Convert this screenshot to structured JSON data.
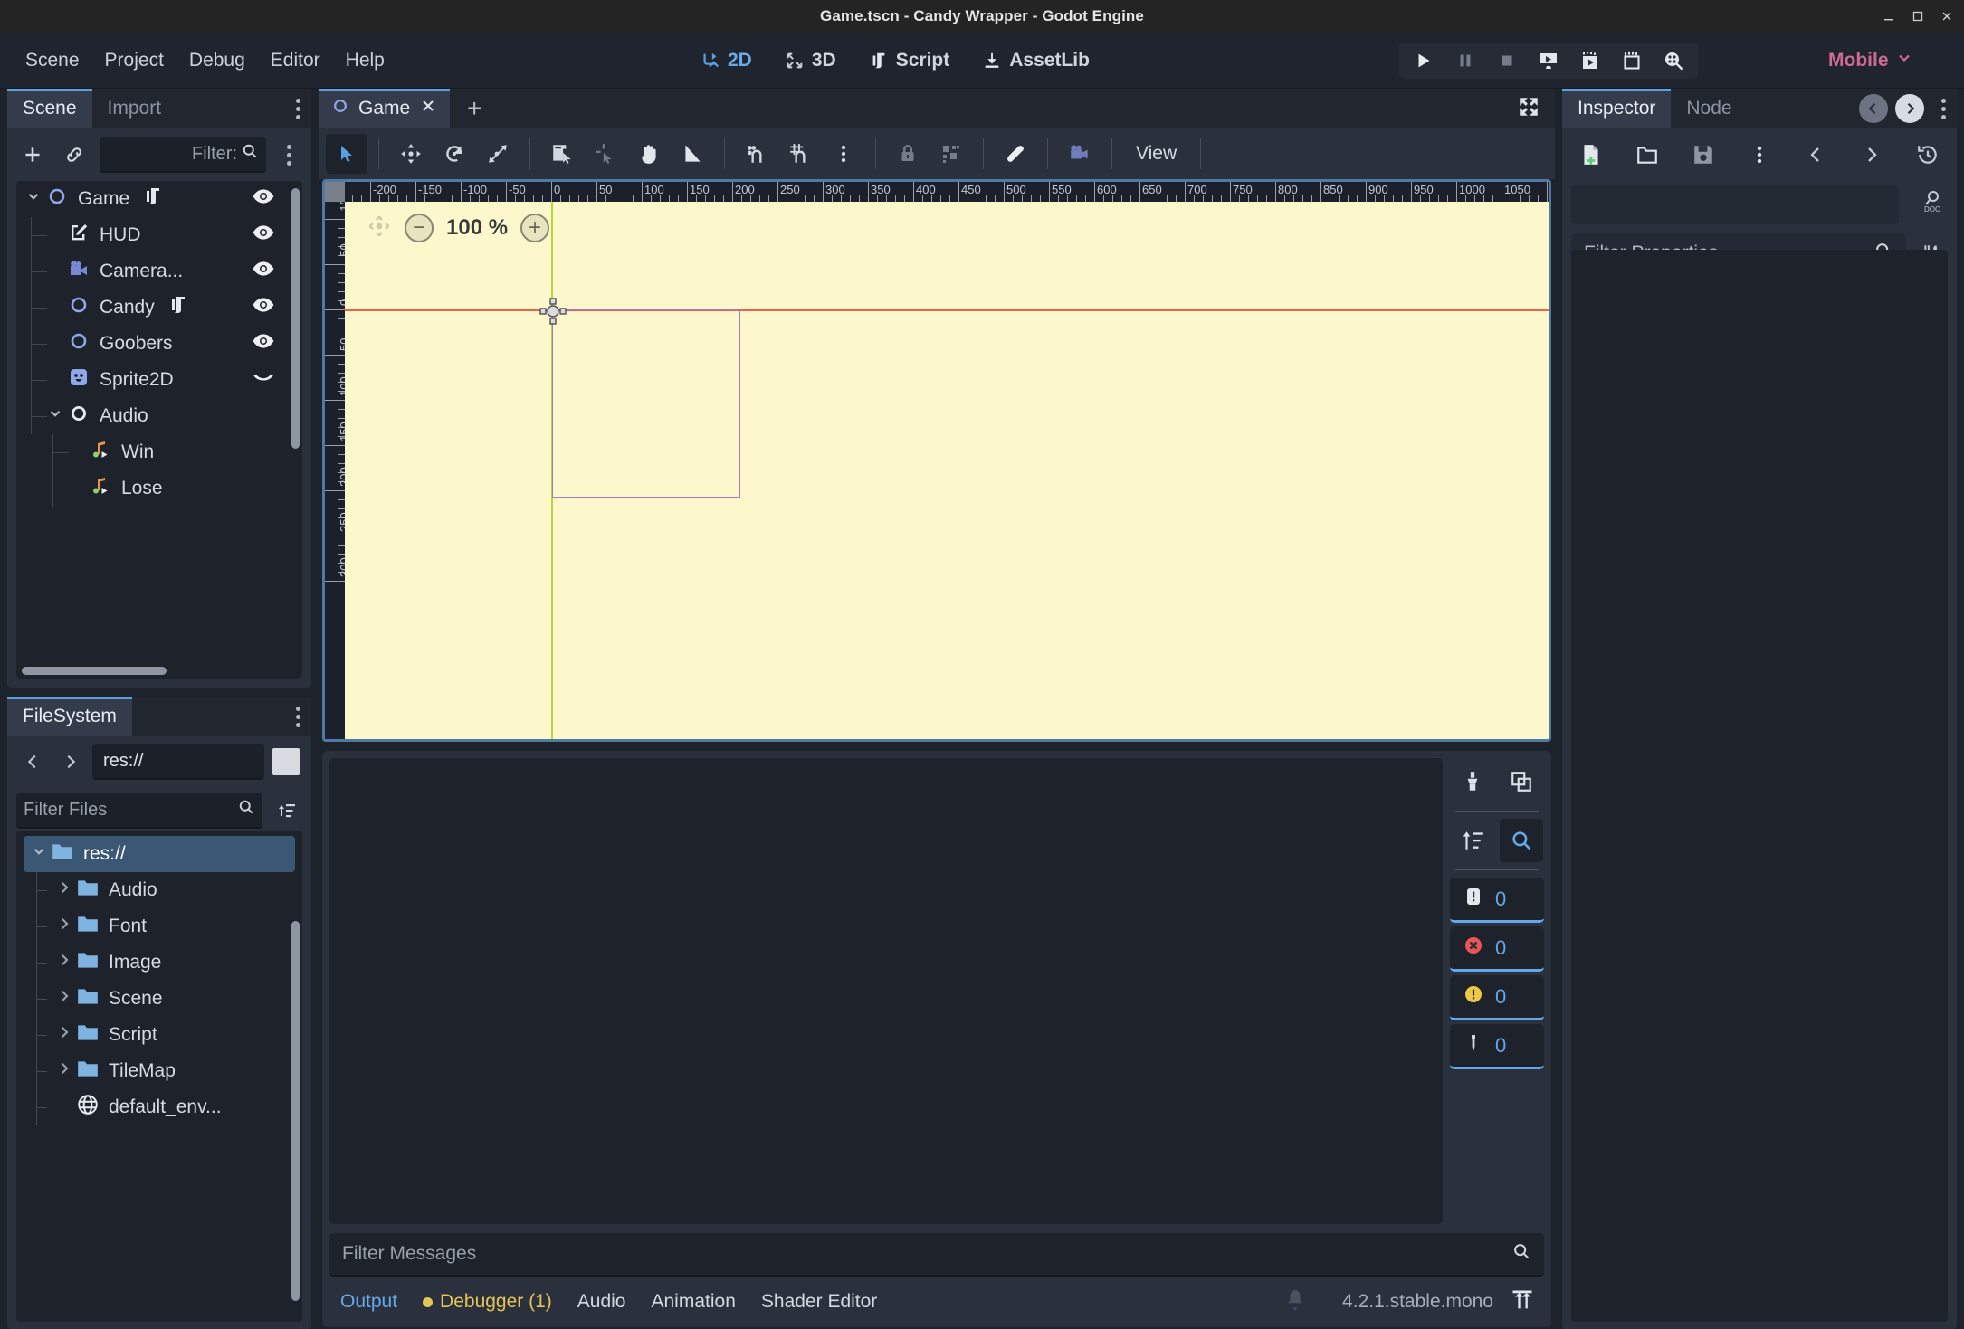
{
  "window": {
    "title": "Game.tscn - Candy Wrapper - Godot Engine",
    "buttons": [
      "minimize",
      "maximize",
      "close"
    ]
  },
  "menubar": {
    "items": [
      "Scene",
      "Project",
      "Debug",
      "Editor",
      "Help"
    ],
    "main_modes": [
      {
        "label": "2D",
        "icon": "2d-icon",
        "active": true
      },
      {
        "label": "3D",
        "icon": "3d-icon",
        "active": false
      },
      {
        "label": "Script",
        "icon": "script-icon",
        "active": false
      },
      {
        "label": "AssetLib",
        "icon": "assetlib-icon",
        "active": false
      }
    ],
    "run_buttons": [
      "play-icon",
      "pause-icon",
      "stop-icon",
      "play-scene-icon",
      "play-custom-scene-icon",
      "movie-writer-icon",
      "remote-debug-icon"
    ],
    "renderer": "Mobile"
  },
  "scene_dock": {
    "tabs": [
      {
        "label": "Scene",
        "active": true
      },
      {
        "label": "Import",
        "active": false
      }
    ],
    "toolbar": {
      "add_label": "+",
      "link_icon": "instance-child-scene-icon",
      "filter_placeholder": "Filter:",
      "kebab": "scene-options-icon"
    },
    "tree": [
      {
        "label": "Game",
        "depth": 0,
        "icon": "node2d-icon",
        "expanded": true,
        "script": true,
        "visibility": true
      },
      {
        "label": "HUD",
        "depth": 1,
        "icon": "canvaslayer-icon",
        "expanded": null,
        "script": false,
        "visibility": true
      },
      {
        "label": "Camera...",
        "depth": 1,
        "icon": "camera2d-icon",
        "expanded": null,
        "script": false,
        "visibility": true
      },
      {
        "label": "Candy",
        "depth": 1,
        "icon": "node2d-icon",
        "expanded": null,
        "script": true,
        "visibility": true
      },
      {
        "label": "Goobers",
        "depth": 1,
        "icon": "node2d-icon",
        "expanded": null,
        "script": false,
        "visibility": true
      },
      {
        "label": "Sprite2D",
        "depth": 1,
        "icon": "sprite2d-icon",
        "expanded": null,
        "script": false,
        "visibility": false
      },
      {
        "label": "Audio",
        "depth": 1,
        "icon": "node-icon",
        "expanded": true,
        "script": false,
        "visibility": null
      },
      {
        "label": "Win",
        "depth": 2,
        "icon": "audiostream-icon",
        "expanded": null,
        "script": false,
        "visibility": null
      },
      {
        "label": "Lose",
        "depth": 2,
        "icon": "audiostream-icon",
        "expanded": null,
        "script": false,
        "visibility": null
      }
    ]
  },
  "filesystem_dock": {
    "tabs": [
      {
        "label": "FileSystem",
        "active": true
      }
    ],
    "nav": {
      "back_icon": "chevron-left-icon",
      "forward_icon": "chevron-right-icon",
      "path": "res://",
      "toggle_split_icon": "toggle-split-mode-icon"
    },
    "filter_placeholder": "Filter Files",
    "sort_icon": "sort-icon",
    "tree": [
      {
        "label": "res://",
        "depth": 0,
        "icon": "folder-icon",
        "expanded": true,
        "selected": true
      },
      {
        "label": "Audio",
        "depth": 1,
        "icon": "folder-icon",
        "expanded": false,
        "selected": false
      },
      {
        "label": "Font",
        "depth": 1,
        "icon": "folder-icon",
        "expanded": false,
        "selected": false
      },
      {
        "label": "Image",
        "depth": 1,
        "icon": "folder-icon",
        "expanded": false,
        "selected": false
      },
      {
        "label": "Scene",
        "depth": 1,
        "icon": "folder-icon",
        "expanded": false,
        "selected": false
      },
      {
        "label": "Script",
        "depth": 1,
        "icon": "folder-icon",
        "expanded": false,
        "selected": false
      },
      {
        "label": "TileMap",
        "depth": 1,
        "icon": "folder-icon",
        "expanded": false,
        "selected": false
      },
      {
        "label": "default_env...",
        "depth": 1,
        "icon": "environment-icon",
        "expanded": null,
        "selected": false
      }
    ]
  },
  "editor": {
    "scene_tabs": [
      {
        "label": "Game",
        "icon": "node2d-icon",
        "active": true,
        "close": "✕"
      }
    ],
    "add_tab_label": "+",
    "distraction_free_icon": "distraction-free-icon",
    "canvas_toolbar": [
      {
        "icon": "select-mode-icon",
        "name": "select-tool",
        "selected": true,
        "dim": false
      },
      {
        "sep": true
      },
      {
        "icon": "move-mode-icon",
        "name": "move-tool",
        "selected": false,
        "dim": false
      },
      {
        "icon": "rotate-mode-icon",
        "name": "rotate-tool",
        "selected": false,
        "dim": false
      },
      {
        "icon": "scale-mode-icon",
        "name": "scale-tool",
        "selected": false,
        "dim": false
      },
      {
        "sep": true
      },
      {
        "icon": "list-select-icon",
        "name": "list-select",
        "selected": false,
        "dim": false
      },
      {
        "icon": "pivot-tool-icon",
        "name": "pivot-tool",
        "selected": false,
        "dim": true
      },
      {
        "icon": "pan-mode-icon",
        "name": "pan-tool",
        "selected": false,
        "dim": false
      },
      {
        "icon": "ruler-mode-icon",
        "name": "ruler-tool",
        "selected": false,
        "dim": false
      },
      {
        "sep": true
      },
      {
        "icon": "snap-mode-icon",
        "name": "use-snap",
        "selected": false,
        "dim": false
      },
      {
        "icon": "grid-snap-icon",
        "name": "grid-snap",
        "selected": false,
        "dim": false
      },
      {
        "icon": "kebab-icon",
        "name": "snap-options",
        "selected": false,
        "dim": false
      },
      {
        "sep": true
      },
      {
        "icon": "lock-icon",
        "name": "lock-selected",
        "selected": false,
        "dim": true
      },
      {
        "icon": "group-icon",
        "name": "group-selected",
        "selected": false,
        "dim": true
      },
      {
        "sep": true
      },
      {
        "icon": "bone-icon",
        "name": "skeleton-options",
        "selected": false,
        "dim": false
      },
      {
        "sep": true
      },
      {
        "icon": "camera-override-icon",
        "name": "camera-override",
        "selected": false,
        "dim": false
      },
      {
        "sep": true
      }
    ],
    "view_menu": "View",
    "zoom": {
      "reset_icon": "zoom-reset-icon",
      "minus": "−",
      "value": "100 %",
      "plus": "+"
    },
    "ruler": {
      "h_labels": [
        "-100",
        "-50",
        "0",
        "50",
        "100",
        "150",
        "200",
        "250",
        "300",
        "350",
        "400",
        "450",
        "50"
      ],
      "v_labels": [
        "-50",
        "0",
        "50",
        "100",
        "150",
        "200"
      ],
      "unit_step": 50
    },
    "canvas": {
      "background_color": "#fcf8cc",
      "guide_x_color": "#b7d43a",
      "guide_y_color": "#f0604a",
      "rect_color": "#a07ec6",
      "origin_label": "origin-gizmo"
    }
  },
  "bottom_panel": {
    "side_buttons": [
      {
        "icon": "clear-output-icon",
        "name": "clear-output"
      },
      {
        "icon": "copy-icon",
        "name": "copy-output"
      },
      {
        "icon": "collapse-icon",
        "name": "collapse-output"
      },
      {
        "icon": "search-icon",
        "name": "search-output",
        "active": true
      }
    ],
    "counters": [
      {
        "icon": "log-message-icon",
        "name": "std-messages",
        "count": "0",
        "color": "#e4e7ec"
      },
      {
        "icon": "log-error-icon",
        "name": "errors",
        "count": "0",
        "color": "#ec5555"
      },
      {
        "icon": "log-warning-icon",
        "name": "warnings",
        "count": "0",
        "color": "#ecc946"
      },
      {
        "icon": "log-editor-icon",
        "name": "editor-messages",
        "count": "0",
        "color": "#d3d8e0"
      }
    ],
    "filter_placeholder": "Filter Messages",
    "search_icon": "search-icon",
    "tabs": [
      {
        "label": "Output",
        "active": true,
        "dot": false
      },
      {
        "label": "Debugger (1)",
        "active": false,
        "dot": true,
        "warn": true
      },
      {
        "label": "Audio",
        "active": false,
        "dot": false
      },
      {
        "label": "Animation",
        "active": false,
        "dot": false
      },
      {
        "label": "Shader Editor",
        "active": false,
        "dot": false
      }
    ],
    "bell_icon": "notification-bell-icon",
    "version": "4.2.1.stable.mono",
    "expand_icon": "expand-bottom-panel-icon"
  },
  "inspector_dock": {
    "tabs": [
      {
        "label": "Inspector",
        "active": true
      },
      {
        "label": "Node",
        "active": false
      }
    ],
    "nav_prev_icon": "history-prev-icon",
    "nav_next_icon": "history-next-icon",
    "kebab_icon": "inspector-options-icon",
    "toolbar": [
      {
        "icon": "new-resource-icon",
        "name": "new-resource"
      },
      {
        "icon": "load-resource-icon",
        "name": "load-resource"
      },
      {
        "icon": "save-resource-icon",
        "name": "save-resource"
      },
      {
        "icon": "kebab-icon",
        "name": "resource-extra-options"
      },
      {
        "icon": "chevron-left-icon",
        "name": "inspector-back"
      },
      {
        "icon": "chevron-right-icon",
        "name": "inspector-forward"
      },
      {
        "icon": "history-icon",
        "name": "inspector-history"
      }
    ],
    "doc_icon": "open-documentation-icon",
    "filter_placeholder": "Filter Properties",
    "tools_icon": "object-tools-icon"
  },
  "colors": {
    "accent": "#5a9fe0",
    "panel_bg": "#2a303c",
    "dark_bg": "#1d222b",
    "title_bg": "#242424",
    "menu_bg": "#1f242e",
    "renderer": "#cf6b92",
    "warning": "#e5c558",
    "canvas": "#fcf8cc"
  }
}
